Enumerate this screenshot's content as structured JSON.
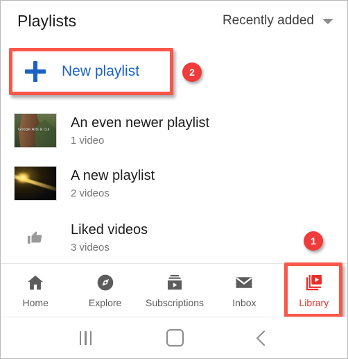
{
  "header": {
    "title": "Playlists",
    "sort_label": "Recently added",
    "sort_caret_icon": "chevron-down-icon"
  },
  "new_playlist": {
    "label": "New playlist",
    "plus_icon": "plus-icon",
    "accent_color": "#1a62c4"
  },
  "annotations": {
    "highlight_color": "#f9574a",
    "badge_color": "#ef3b3b",
    "badges": [
      {
        "number": "1",
        "target": "library-tab"
      },
      {
        "number": "2",
        "target": "new-playlist-button"
      }
    ]
  },
  "playlists": [
    {
      "title": "An even newer playlist",
      "count": "1 video",
      "thumbnail": "canyon-landscape-thumbnail",
      "thumbnail_overlay_text": "Google Arts & Cul"
    },
    {
      "title": "A new playlist",
      "count": "2 videos",
      "thumbnail": "space-light-streak-thumbnail",
      "thumbnail_overlay_text": ""
    },
    {
      "title": "Liked videos",
      "count": "3 videos",
      "thumbnail": "thumbs-up-icon",
      "thumbnail_overlay_text": ""
    }
  ],
  "bottom_nav": {
    "active_color": "#e8302a",
    "inactive_color": "#5c5c5c",
    "items": [
      {
        "label": "Home",
        "icon": "home-icon",
        "active": false
      },
      {
        "label": "Explore",
        "icon": "compass-icon",
        "active": false
      },
      {
        "label": "Subscriptions",
        "icon": "subscriptions-icon",
        "active": false
      },
      {
        "label": "Inbox",
        "icon": "envelope-icon",
        "active": false
      },
      {
        "label": "Library",
        "icon": "library-icon",
        "active": true
      }
    ]
  },
  "system_bar": {
    "recents_icon": "recents-icon",
    "home_icon": "home-button-icon",
    "back_icon": "back-chevron-icon"
  }
}
